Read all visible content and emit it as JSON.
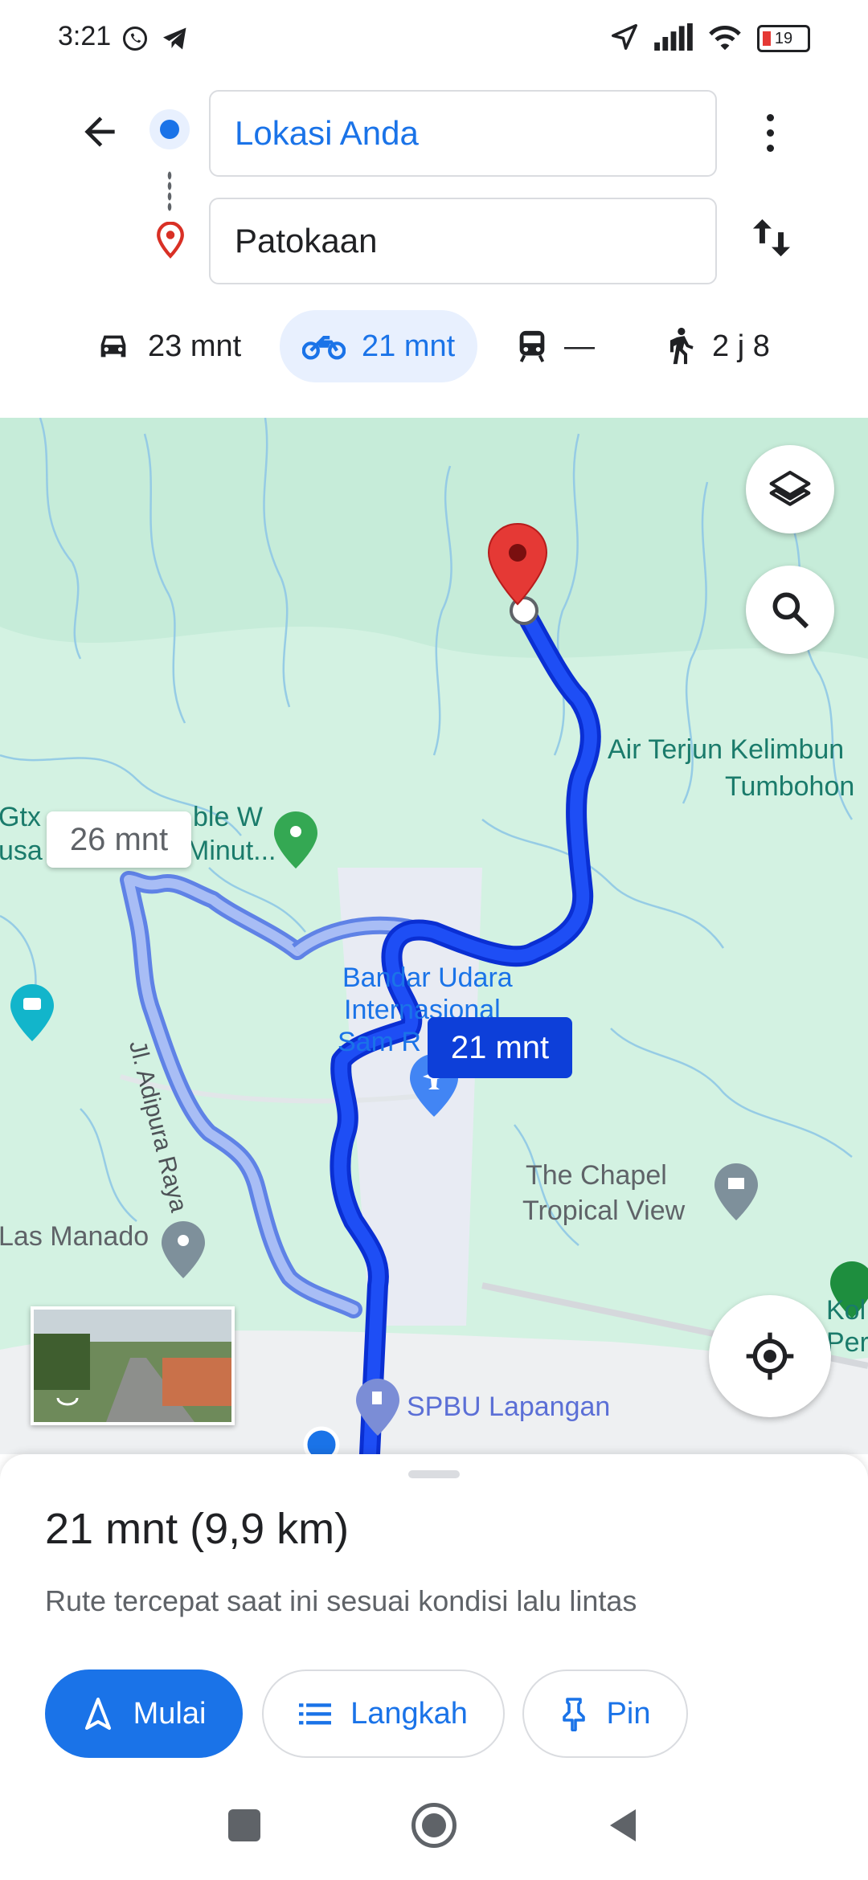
{
  "status_bar": {
    "time": "3:21",
    "battery": "19"
  },
  "route_inputs": {
    "origin": "Lokasi Anda",
    "destination": "Patokaan"
  },
  "travel_modes": [
    {
      "icon": "car-icon",
      "label": "23 mnt"
    },
    {
      "icon": "motorcycle-icon",
      "label": "21 mnt",
      "selected": true
    },
    {
      "icon": "transit-icon",
      "label": "—"
    },
    {
      "icon": "walk-icon",
      "label": "2 j 8"
    }
  ],
  "map": {
    "labels": {
      "gtx": "Gtx",
      "gtx_right": "ble W",
      "usa": "usa",
      "usa_right": "Minut...",
      "waterfall": "Air Terjun Kelimbun",
      "tumbohon": "Tumbohon",
      "airport_1": "Bandar Udara",
      "airport_2": "Internasional",
      "airport_3": "Sam R",
      "road": "Jl. Adipura Raya",
      "chapel_1": "The Chapel",
      "chapel_2": "Tropical View",
      "manado": "Las Manado",
      "spbu": "SPBU Lapangan",
      "kol": "Kol",
      "per": "Per"
    },
    "alt_route_time": "26 mnt",
    "main_route_time": "21 mnt"
  },
  "summary": {
    "duration": "21 mnt",
    "distance": "(9,9 km)",
    "description": "Rute tercepat saat ini sesuai kondisi lalu lintas"
  },
  "actions": {
    "start": "Mulai",
    "steps": "Langkah",
    "pin": "Pin"
  },
  "colors": {
    "accent": "#1a73e8",
    "route_main": "#0d3fd9",
    "route_alt": "#8fa8f0",
    "map_bg": "#d3f2e2"
  }
}
